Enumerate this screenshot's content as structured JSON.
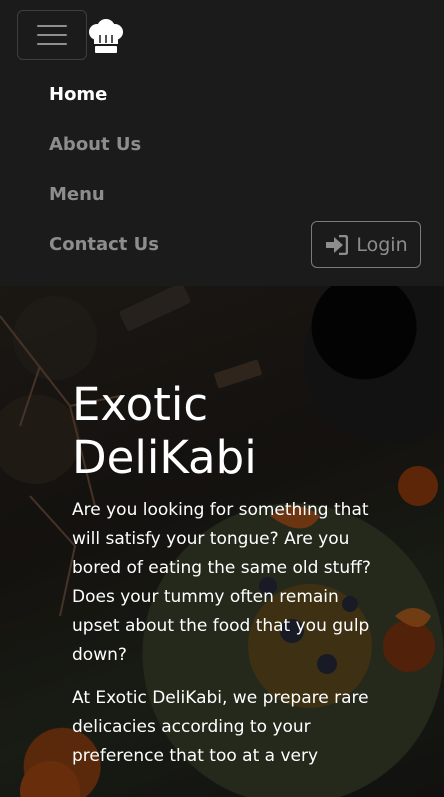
{
  "nav": {
    "toggler_label": "Toggle navigation",
    "brand_icon": "chef-hat-icon",
    "items": [
      {
        "label": "Home",
        "active": true
      },
      {
        "label": "About Us",
        "active": false
      },
      {
        "label": "Menu",
        "active": false
      },
      {
        "label": "Contact Us",
        "active": false
      }
    ],
    "login": {
      "label": "Login",
      "icon": "sign-in-icon"
    }
  },
  "hero": {
    "title": "Exotic DeliKabi",
    "paragraphs": [
      "Are you looking for something that will satisfy your tongue? Are you bored of eating the same old stuff? Does your tummy often remain upset about the food that you gulp down?",
      "At Exotic DeliKabi, we prepare rare delicacies according to your preference that too at a very"
    ]
  },
  "colors": {
    "nav_bg": "#1c1b1b",
    "nav_active": "#ffffff",
    "nav_inactive": "#8d8d8d",
    "hero_text": "#ffffff"
  }
}
